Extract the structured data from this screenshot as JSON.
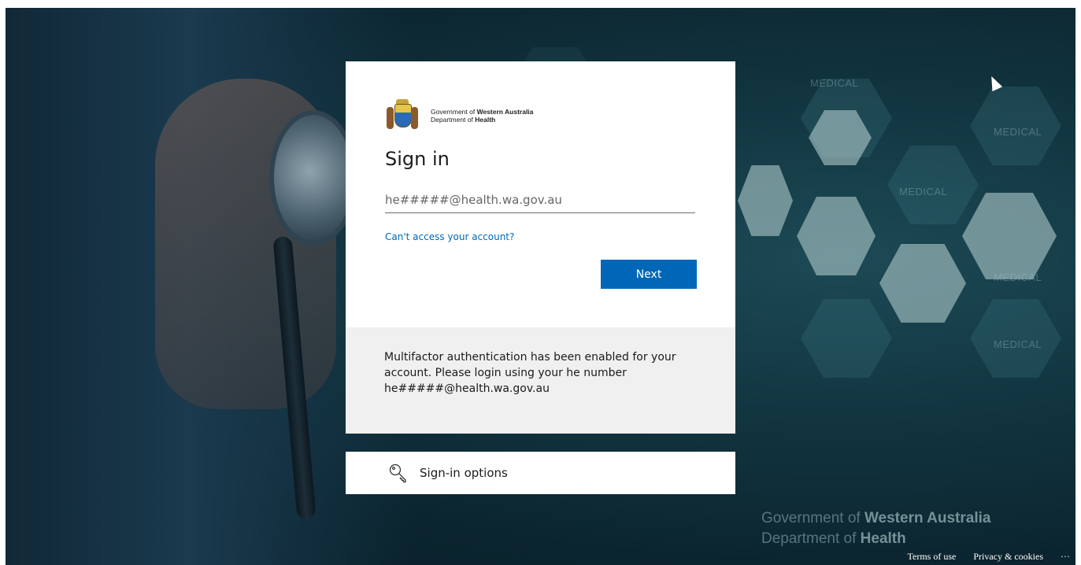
{
  "background": {
    "words": [
      "MEDICAL",
      "MEDICAL",
      "MEDICAL",
      "MEDICAL",
      "MEDICAL"
    ],
    "org_line1_prefix": "Government of ",
    "org_line1_bold": "Western Australia",
    "org_line2_prefix": "Department of ",
    "org_line2_bold": "Health"
  },
  "logo": {
    "line1_prefix": "Government of ",
    "line1_bold": "Western Australia",
    "line2_prefix": "Department of ",
    "line2_bold": "Health"
  },
  "signin": {
    "title": "Sign in",
    "email_placeholder": "he#####@health.wa.gov.au",
    "cant_access": "Can't access your account?",
    "next_label": "Next"
  },
  "notice": {
    "text": "Multifactor authentication has been enabled for your account. Please login using your he number he#####@health.wa.gov.au"
  },
  "options": {
    "label": "Sign-in options",
    "icon": "key-icon"
  },
  "footer": {
    "terms": "Terms of use",
    "privacy": "Privacy & cookies",
    "more": "···"
  },
  "colors": {
    "accent": "#0067b8",
    "notice_bg": "#f0f0f0"
  }
}
